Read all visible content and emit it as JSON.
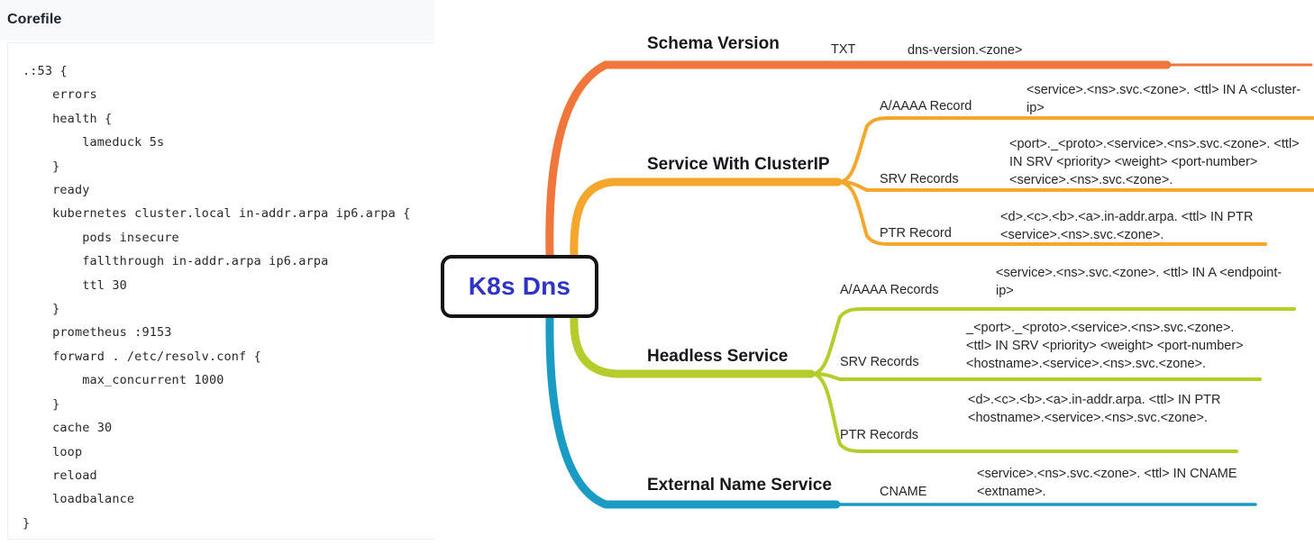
{
  "corefile": {
    "title": "Corefile",
    "content": ".:53 {\n    errors\n    health {\n        lameduck 5s\n    }\n    ready\n    kubernetes cluster.local in-addr.arpa ip6.arpa {\n        pods insecure\n        fallthrough in-addr.arpa ip6.arpa\n        ttl 30\n    }\n    prometheus :9153\n    forward . /etc/resolv.conf {\n        max_concurrent 1000\n    }\n    cache 30\n    loop\n    reload\n    loadbalance\n}"
  },
  "mindmap": {
    "root": {
      "label": "K8s Dns",
      "text_color": "#2f34c4",
      "border_color": "#141414"
    },
    "branches": [
      {
        "label": "Schema Version",
        "color": "#f0763c",
        "leaves": [
          {
            "label": "TXT",
            "detail": "dns-version.<zone>"
          }
        ]
      },
      {
        "label": "Service With ClusterIP",
        "color": "#f5a72b",
        "leaves": [
          {
            "label": "A/AAAA Record",
            "detail": "<service>.<ns>.svc.<zone>. <ttl> IN A <cluster-ip>"
          },
          {
            "label": "SRV Records",
            "detail": "<port>._<proto>.<service>.<ns>.svc.<zone>. <ttl> IN SRV <priority> <weight> <port-number> <service>.<ns>.svc.<zone>."
          },
          {
            "label": "PTR Record",
            "detail": "<d>.<c>.<b>.<a>.in-addr.arpa. <ttl> IN PTR <service>.<ns>.svc.<zone>."
          }
        ]
      },
      {
        "label": "Headless Service",
        "color": "#b5cc2b",
        "leaves": [
          {
            "label": "A/AAAA Records",
            "detail": "<service>.<ns>.svc.<zone>. <ttl> IN A <endpoint-ip>"
          },
          {
            "label": "SRV Records",
            "detail": "_<port>._<proto>.<service>.<ns>.svc.<zone>. <ttl> IN SRV <priority> <weight> <port-number> <hostname>.<service>.<ns>.svc.<zone>."
          },
          {
            "label": "PTR Records",
            "detail": "<d>.<c>.<b>.<a>.in-addr.arpa. <ttl> IN PTR <hostname>.<service>.<ns>.svc.<zone>."
          }
        ]
      },
      {
        "label": "External Name Service",
        "color": "#1a9bc4",
        "leaves": [
          {
            "label": "CNAME",
            "detail": "<service>.<ns>.svc.<zone>. <ttl> IN CNAME <extname>."
          }
        ]
      }
    ]
  }
}
